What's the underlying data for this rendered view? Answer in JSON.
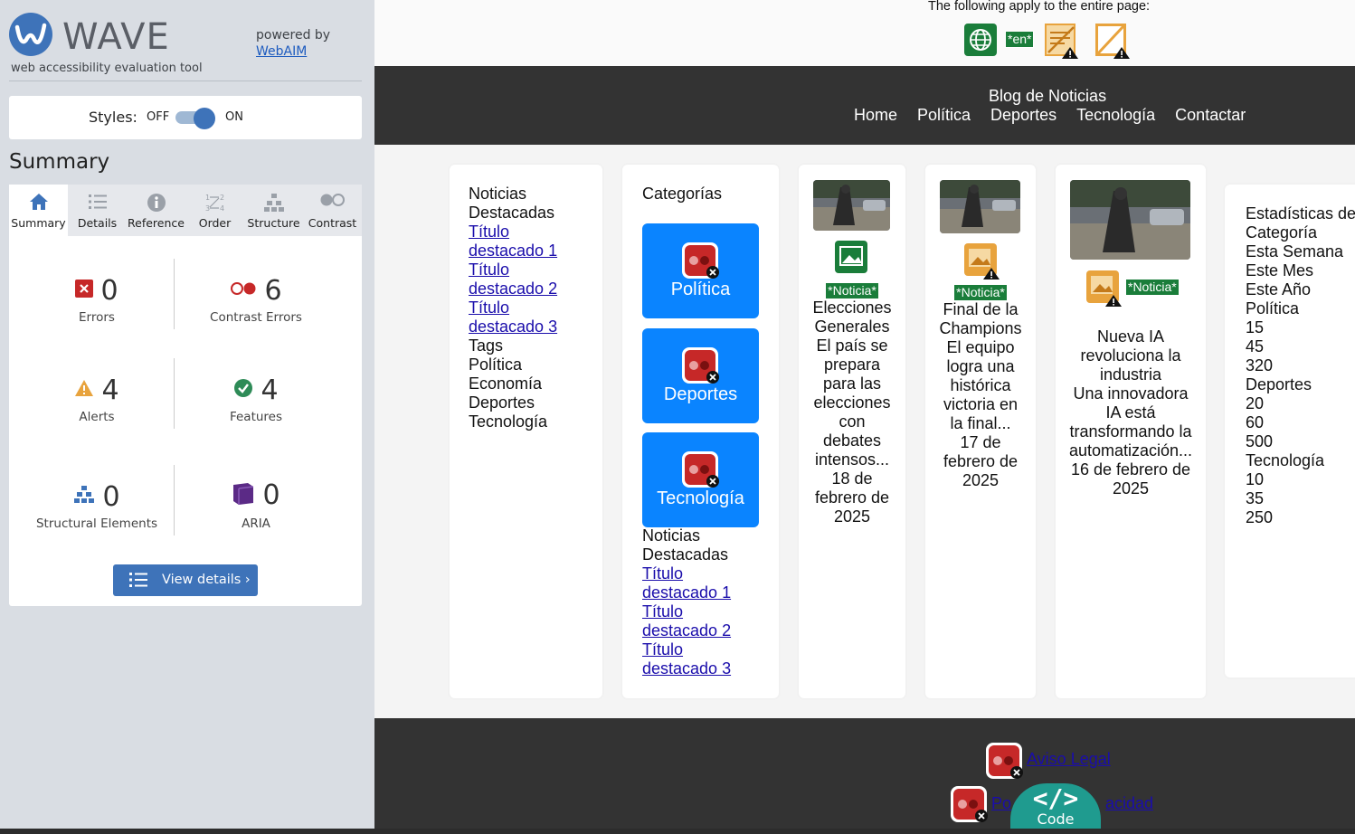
{
  "wave": {
    "logo_word": "WAVE",
    "tagline": "web accessibility evaluation tool",
    "powered_by": "powered by",
    "webaim": "WebAIM",
    "styles_label": "Styles:",
    "styles_off": "OFF",
    "styles_on": "ON",
    "summary_title": "Summary",
    "tabs": [
      {
        "label": "Summary",
        "icon": "home-icon"
      },
      {
        "label": "Details",
        "icon": "list-icon"
      },
      {
        "label": "Reference",
        "icon": "info-icon"
      },
      {
        "label": "Order",
        "icon": "order-icon"
      },
      {
        "label": "Structure",
        "icon": "structure-icon"
      },
      {
        "label": "Contrast",
        "icon": "contrast-icon"
      }
    ],
    "metrics": {
      "errors": {
        "value": "0",
        "label": "Errors"
      },
      "contrast": {
        "value": "6",
        "label": "Contrast Errors"
      },
      "alerts": {
        "value": "4",
        "label": "Alerts"
      },
      "features": {
        "value": "4",
        "label": "Features"
      },
      "structure": {
        "value": "0",
        "label": "Structural Elements"
      },
      "aria": {
        "value": "0",
        "label": "ARIA"
      }
    },
    "view_details": "View details ›",
    "colors": {
      "accent": "#3e73b9",
      "error": "#c62828",
      "alert": "#e8a33d",
      "feature": "#2e8b57",
      "aria": "#5b2a86"
    }
  },
  "page": {
    "apply_text": "The following apply to the entire page:",
    "lang_badge": "*en*",
    "site_title": "Blog de Noticias",
    "nav": [
      "Home",
      "Política",
      "Deportes",
      "Tecnología",
      "Contactar"
    ],
    "featured1": {
      "title_lines": [
        "Noticias",
        "Destacadas"
      ],
      "links": [
        [
          "Título",
          "destacado 1"
        ],
        [
          "Título",
          "destacado 2"
        ],
        [
          "Título",
          "destacado 3"
        ]
      ],
      "tags": [
        "Tags",
        "Política",
        "Economía",
        "Deportes",
        "Tecnología"
      ]
    },
    "categories": {
      "title": "Categorías",
      "buttons": [
        "Política",
        "Deportes",
        "Tecnología"
      ],
      "featured_title": [
        "Noticias",
        "Destacadas"
      ],
      "links": [
        [
          "Título",
          "destacado 1"
        ],
        [
          "Título",
          "destacado 2"
        ],
        [
          "Título",
          "destacado 3"
        ]
      ]
    },
    "news": [
      {
        "badge": "*Noticia*",
        "lines": [
          "Elecciones",
          "Generales",
          "El país se",
          "prepara",
          "para las",
          "elecciones",
          "con",
          "debates",
          "intensos...",
          "18 de",
          "febrero de",
          "2025"
        ]
      },
      {
        "badge": "*Noticia*",
        "lines": [
          "Final de la",
          "Champions",
          "El equipo",
          "logra una",
          "histórica",
          "victoria en",
          "la final...",
          "17 de",
          "febrero de",
          "2025"
        ]
      },
      {
        "badge": "*Noticia*",
        "lines": [
          "Nueva IA",
          "revoluciona la",
          "industria",
          "Una innovadora",
          "IA está",
          "transformando la",
          "automatización...",
          "16 de febrero de",
          "2025"
        ]
      }
    ],
    "stats": [
      "Estadísticas de",
      "Categoría",
      "Esta Semana",
      "Este Mes",
      "Este Año",
      "Política",
      "15",
      "45",
      "320",
      "Deportes",
      "20",
      "60",
      "500",
      "Tecnología",
      "10",
      "35",
      "250"
    ],
    "footer_links": [
      "Aviso Legal",
      "Po",
      "acidad"
    ],
    "code_label": "Code"
  }
}
